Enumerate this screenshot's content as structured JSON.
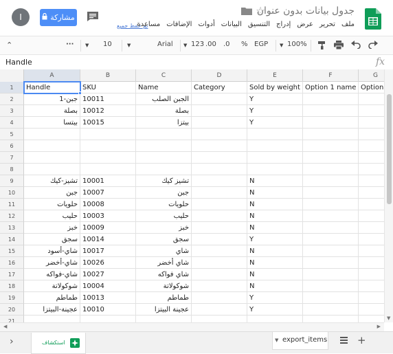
{
  "header": {
    "avatar_letter": "I",
    "share_label": "مشاركة",
    "doc_title": "جدول بيانات بدون عنوان",
    "saved_status": "تم حفظ جميع",
    "menu": [
      "ملف",
      "تحرير",
      "عرض",
      "إدراج",
      "التنسيق",
      "البيانات",
      "أدوات",
      "الإضافات",
      "مساعدة"
    ]
  },
  "toolbar": {
    "zoom": "100%",
    "currency": "EGP",
    "percent": "%",
    "decimal_less": ".0",
    "decimal_more": ".00",
    "format_123": "123",
    "font": "Arial",
    "font_size": "10",
    "more": "···"
  },
  "formula_bar": {
    "value": "Handle",
    "fx": "fx"
  },
  "columns": [
    "A",
    "B",
    "C",
    "D",
    "E",
    "F",
    "G"
  ],
  "rows": [
    {
      "n": "1",
      "a": "Handle",
      "b": "SKU",
      "c": "Name",
      "d": "Category",
      "e": "Sold by weight",
      "f": "Option 1 name",
      "g": "Option"
    },
    {
      "n": "2",
      "a": "جبن-1",
      "b": "10011",
      "c": "الجبن الصلب",
      "d": "",
      "e": "Y",
      "f": "",
      "g": ""
    },
    {
      "n": "3",
      "a": "بصلة",
      "b": "10012",
      "c": "بصلة",
      "d": "",
      "e": "Y",
      "f": "",
      "g": ""
    },
    {
      "n": "4",
      "a": "بيتسا",
      "b": "10015",
      "c": "بيتزا",
      "d": "",
      "e": "Y",
      "f": "",
      "g": ""
    },
    {
      "n": "5",
      "a": "",
      "b": "",
      "c": "",
      "d": "",
      "e": "",
      "f": "",
      "g": ""
    },
    {
      "n": "6",
      "a": "",
      "b": "",
      "c": "",
      "d": "",
      "e": "",
      "f": "",
      "g": ""
    },
    {
      "n": "7",
      "a": "",
      "b": "",
      "c": "",
      "d": "",
      "e": "",
      "f": "",
      "g": ""
    },
    {
      "n": "8",
      "a": "",
      "b": "",
      "c": "",
      "d": "",
      "e": "",
      "f": "",
      "g": ""
    },
    {
      "n": "9",
      "a": "تشيز-كيك",
      "b": "10001",
      "c": "تشيز كيك",
      "d": "",
      "e": "N",
      "f": "",
      "g": ""
    },
    {
      "n": "10",
      "a": "جبن",
      "b": "10007",
      "c": "جبن",
      "d": "",
      "e": "N",
      "f": "",
      "g": ""
    },
    {
      "n": "11",
      "a": "حلويات",
      "b": "10008",
      "c": "حلويات",
      "d": "",
      "e": "N",
      "f": "",
      "g": ""
    },
    {
      "n": "12",
      "a": "حليب",
      "b": "10003",
      "c": "حليب",
      "d": "",
      "e": "N",
      "f": "",
      "g": ""
    },
    {
      "n": "13",
      "a": "خبز",
      "b": "10009",
      "c": "خبز",
      "d": "",
      "e": "N",
      "f": "",
      "g": ""
    },
    {
      "n": "14",
      "a": "سجق",
      "b": "10014",
      "c": "سجق",
      "d": "",
      "e": "Y",
      "f": "",
      "g": ""
    },
    {
      "n": "15",
      "a": "شاي-أسود",
      "b": "10017",
      "c": "شاي",
      "d": "",
      "e": "N",
      "f": "",
      "g": ""
    },
    {
      "n": "16",
      "a": "شاي-أخضر",
      "b": "10026",
      "c": "شاي أخضر",
      "d": "",
      "e": "N",
      "f": "",
      "g": ""
    },
    {
      "n": "17",
      "a": "شاي-فواكه",
      "b": "10027",
      "c": "شاي فواكه",
      "d": "",
      "e": "N",
      "f": "",
      "g": ""
    },
    {
      "n": "18",
      "a": "شوكولاتة",
      "b": "10004",
      "c": "شوكولاتة",
      "d": "",
      "e": "N",
      "f": "",
      "g": ""
    },
    {
      "n": "19",
      "a": "طماطم",
      "b": "10013",
      "c": "طماطم",
      "d": "",
      "e": "Y",
      "f": "",
      "g": ""
    },
    {
      "n": "20",
      "a": "عجينة-البيتزا",
      "b": "10010",
      "c": "عجينة البيتزا",
      "d": "",
      "e": "Y",
      "f": "",
      "g": ""
    },
    {
      "n": "21",
      "a": "",
      "b": "",
      "c": "",
      "d": "",
      "e": "",
      "f": "",
      "g": ""
    }
  ],
  "bottom": {
    "explore_label": "استكشاف",
    "sheet_name": "export_items"
  },
  "colors": {
    "accent": "#4d8ef7",
    "sheets_green": "#0f9d58",
    "selection": "#4b89f1"
  }
}
